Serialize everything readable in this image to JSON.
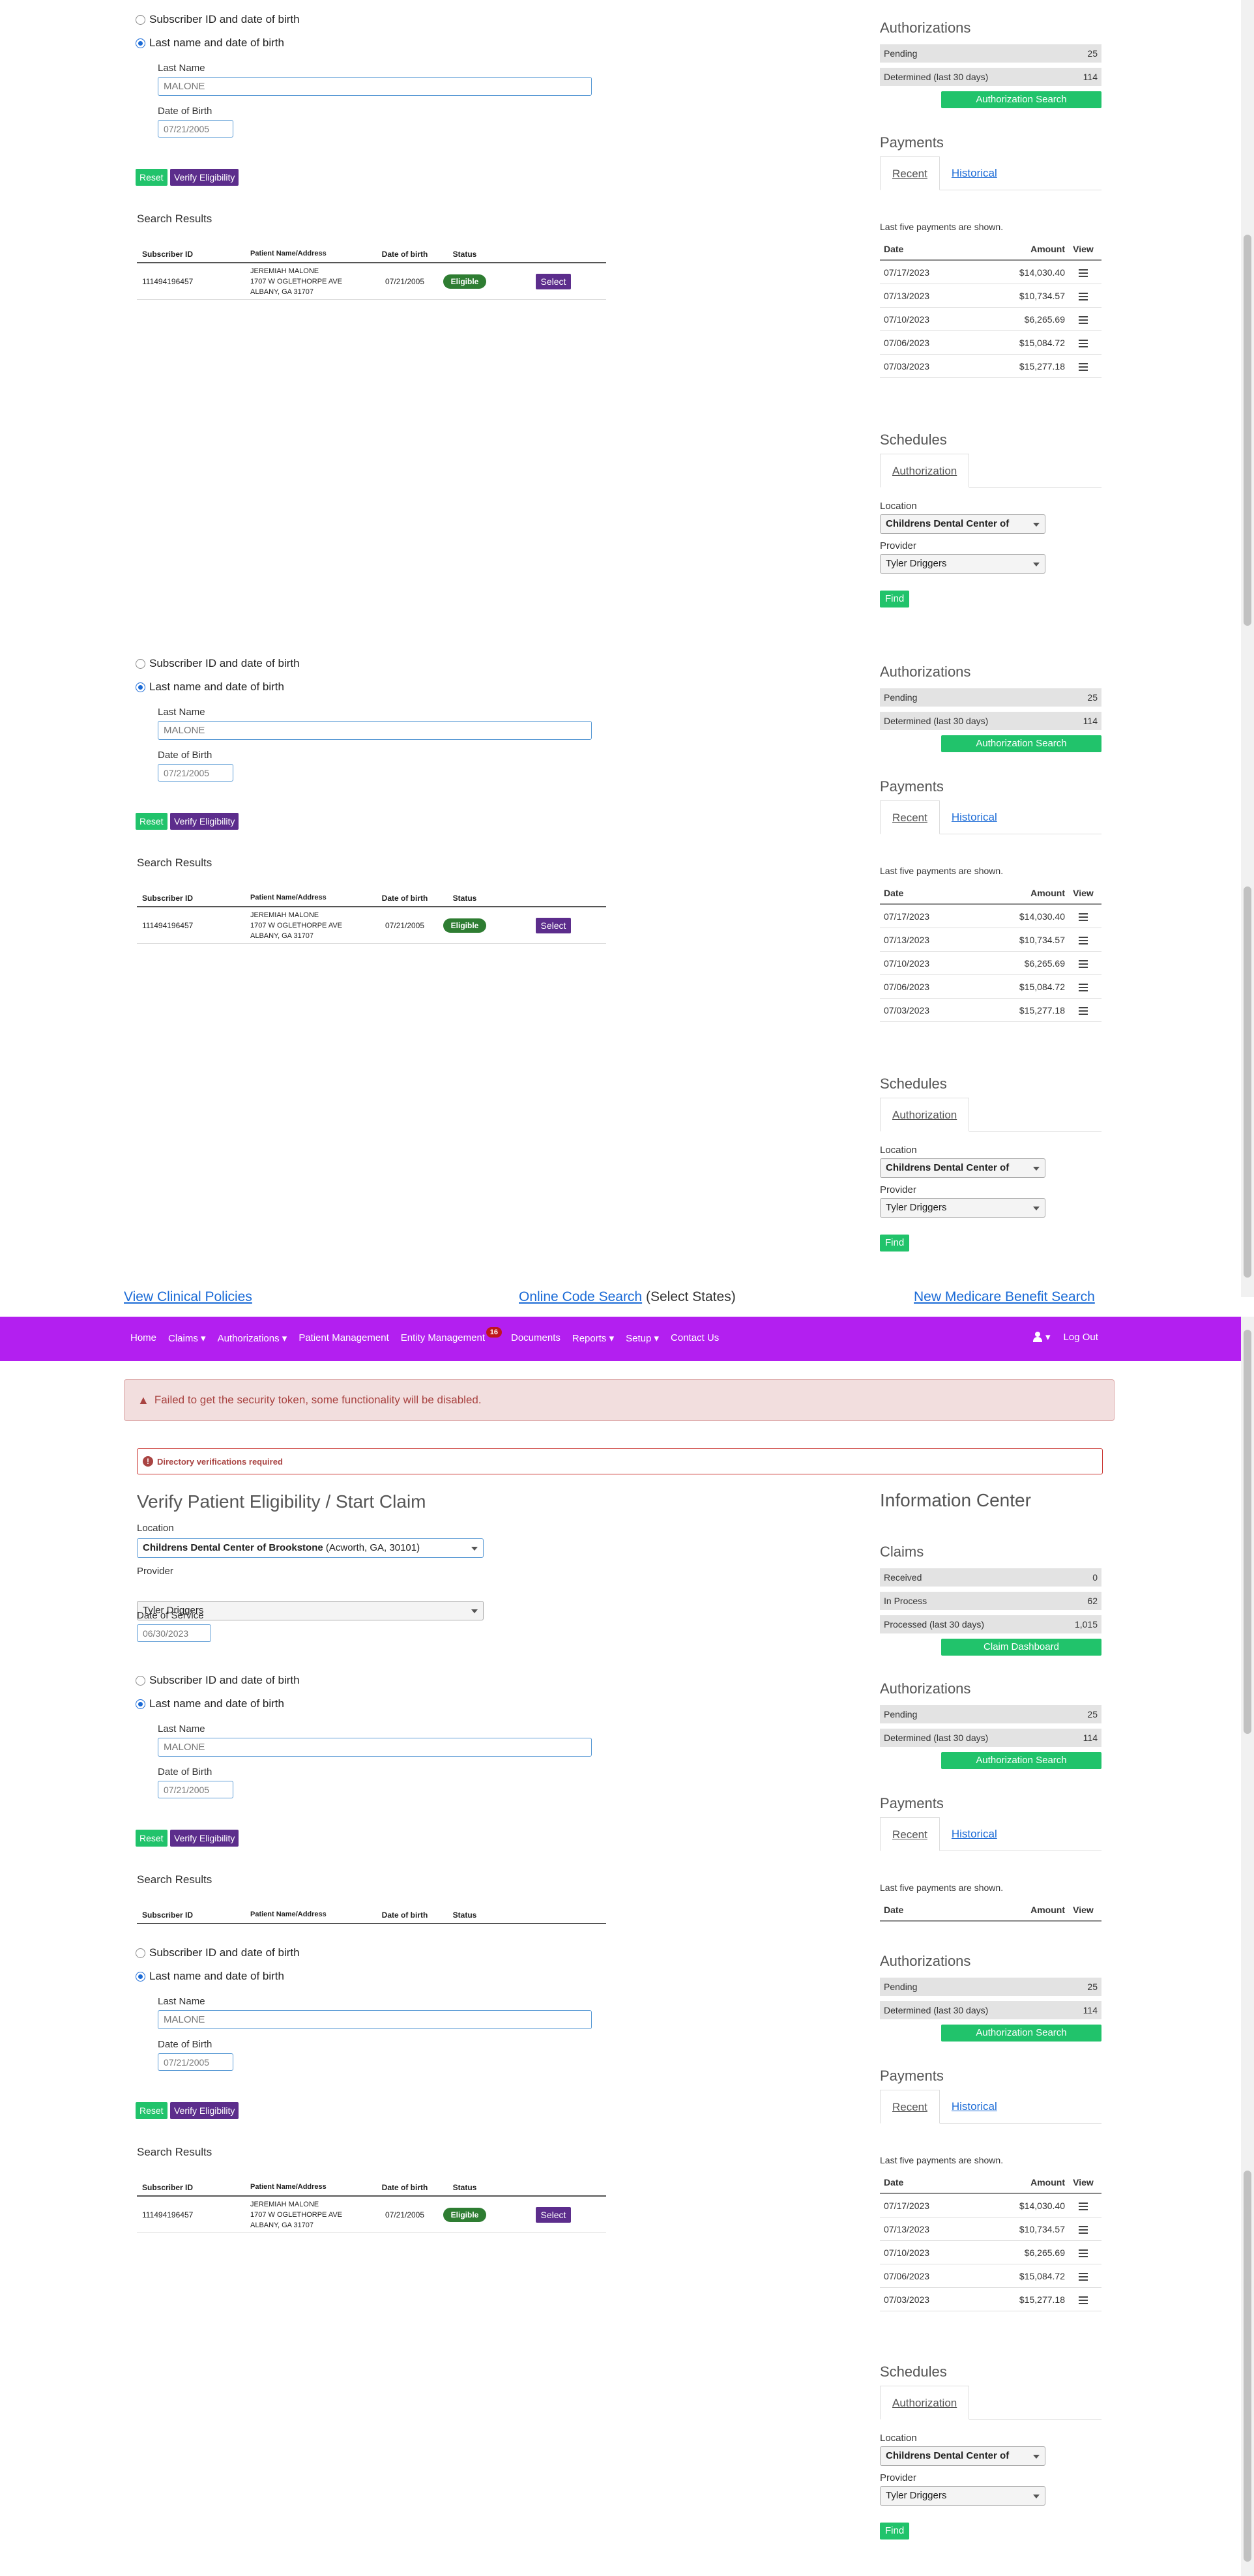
{
  "search_form": {
    "option_subscriber": "Subscriber ID and date of birth",
    "option_lastname": "Last name and date of birth",
    "last_name_label": "Last Name",
    "last_name_value": "MALONE",
    "dob_label": "Date of Birth",
    "dob_value": "07/21/2005",
    "reset_label": "Reset",
    "verify_label": "Verify Eligibility"
  },
  "results": {
    "title": "Search Results",
    "col_subscriber": "Subscriber ID",
    "col_patient": "Patient Name/Address",
    "col_dob": "Date of birth",
    "col_status": "Status",
    "row": {
      "subscriber_id": "111494196457",
      "name": "JEREMIAH MALONE",
      "address1": "1707 W OGLETHORPE AVE",
      "address2": "ALBANY, GA 31707",
      "dob": "07/21/2005",
      "status": "Eligible",
      "select_label": "Select"
    }
  },
  "info_center": {
    "title": "Information Center",
    "claims": {
      "heading": "Claims",
      "rows": [
        {
          "label": "Received",
          "value": "0"
        },
        {
          "label": "In Process",
          "value": "62"
        },
        {
          "label": "Processed (last 30 days)",
          "value": "1,015"
        }
      ],
      "button": "Claim Dashboard"
    },
    "authorizations": {
      "heading": "Authorizations",
      "rows": [
        {
          "label": "Pending",
          "value": "25"
        },
        {
          "label": "Determined (last 30 days)",
          "value": "114"
        }
      ],
      "button": "Authorization Search"
    },
    "payments": {
      "heading": "Payments",
      "tab_recent": "Recent",
      "tab_historical": "Historical",
      "note": "Last five payments are shown.",
      "col_date": "Date",
      "col_amount": "Amount",
      "col_view": "View",
      "rows": [
        {
          "date": "07/17/2023",
          "amount": "$14,030.40"
        },
        {
          "date": "07/13/2023",
          "amount": "$10,734.57"
        },
        {
          "date": "07/10/2023",
          "amount": "$6,265.69"
        },
        {
          "date": "07/06/2023",
          "amount": "$15,084.72"
        },
        {
          "date": "07/03/2023",
          "amount": "$15,277.18"
        }
      ]
    },
    "schedules": {
      "heading": "Schedules",
      "tab_authorization": "Authorization",
      "location_label": "Location",
      "location_value": "Childrens Dental Center of",
      "provider_label": "Provider",
      "provider_value": "Tyler Driggers",
      "find_label": "Find"
    }
  },
  "footer_links": {
    "clinical": "View Clinical Policies",
    "code_search": "Online Code Search",
    "code_search_suffix": "(Select States)",
    "medicare": "New Medicare Benefit Search"
  },
  "nav": {
    "items": [
      "Home",
      "Claims",
      "Authorizations",
      "Patient Management",
      "Entity Management",
      "Documents",
      "Reports",
      "Setup",
      "Contact Us"
    ],
    "entity_badge": "16",
    "logout": "Log Out"
  },
  "alerts": {
    "security": "Failed to get the security token, some functionality will be disabled.",
    "directory": "Directory verifications required"
  },
  "main": {
    "title": "Verify Patient Eligibility / Start Claim",
    "location_label": "Location",
    "location_value": "Childrens Dental Center of Brookstone",
    "location_suffix": "(Acworth, GA, 30101)",
    "provider_label": "Provider",
    "provider_value": "Tyler Driggers",
    "dos_label": "Date of Service",
    "dos_value": "06/30/2023"
  },
  "colors": {
    "nav_bg": "#b31ff0",
    "green": "#21c36b",
    "purple": "#5c2d8c",
    "alert_bg": "#f2dede"
  }
}
